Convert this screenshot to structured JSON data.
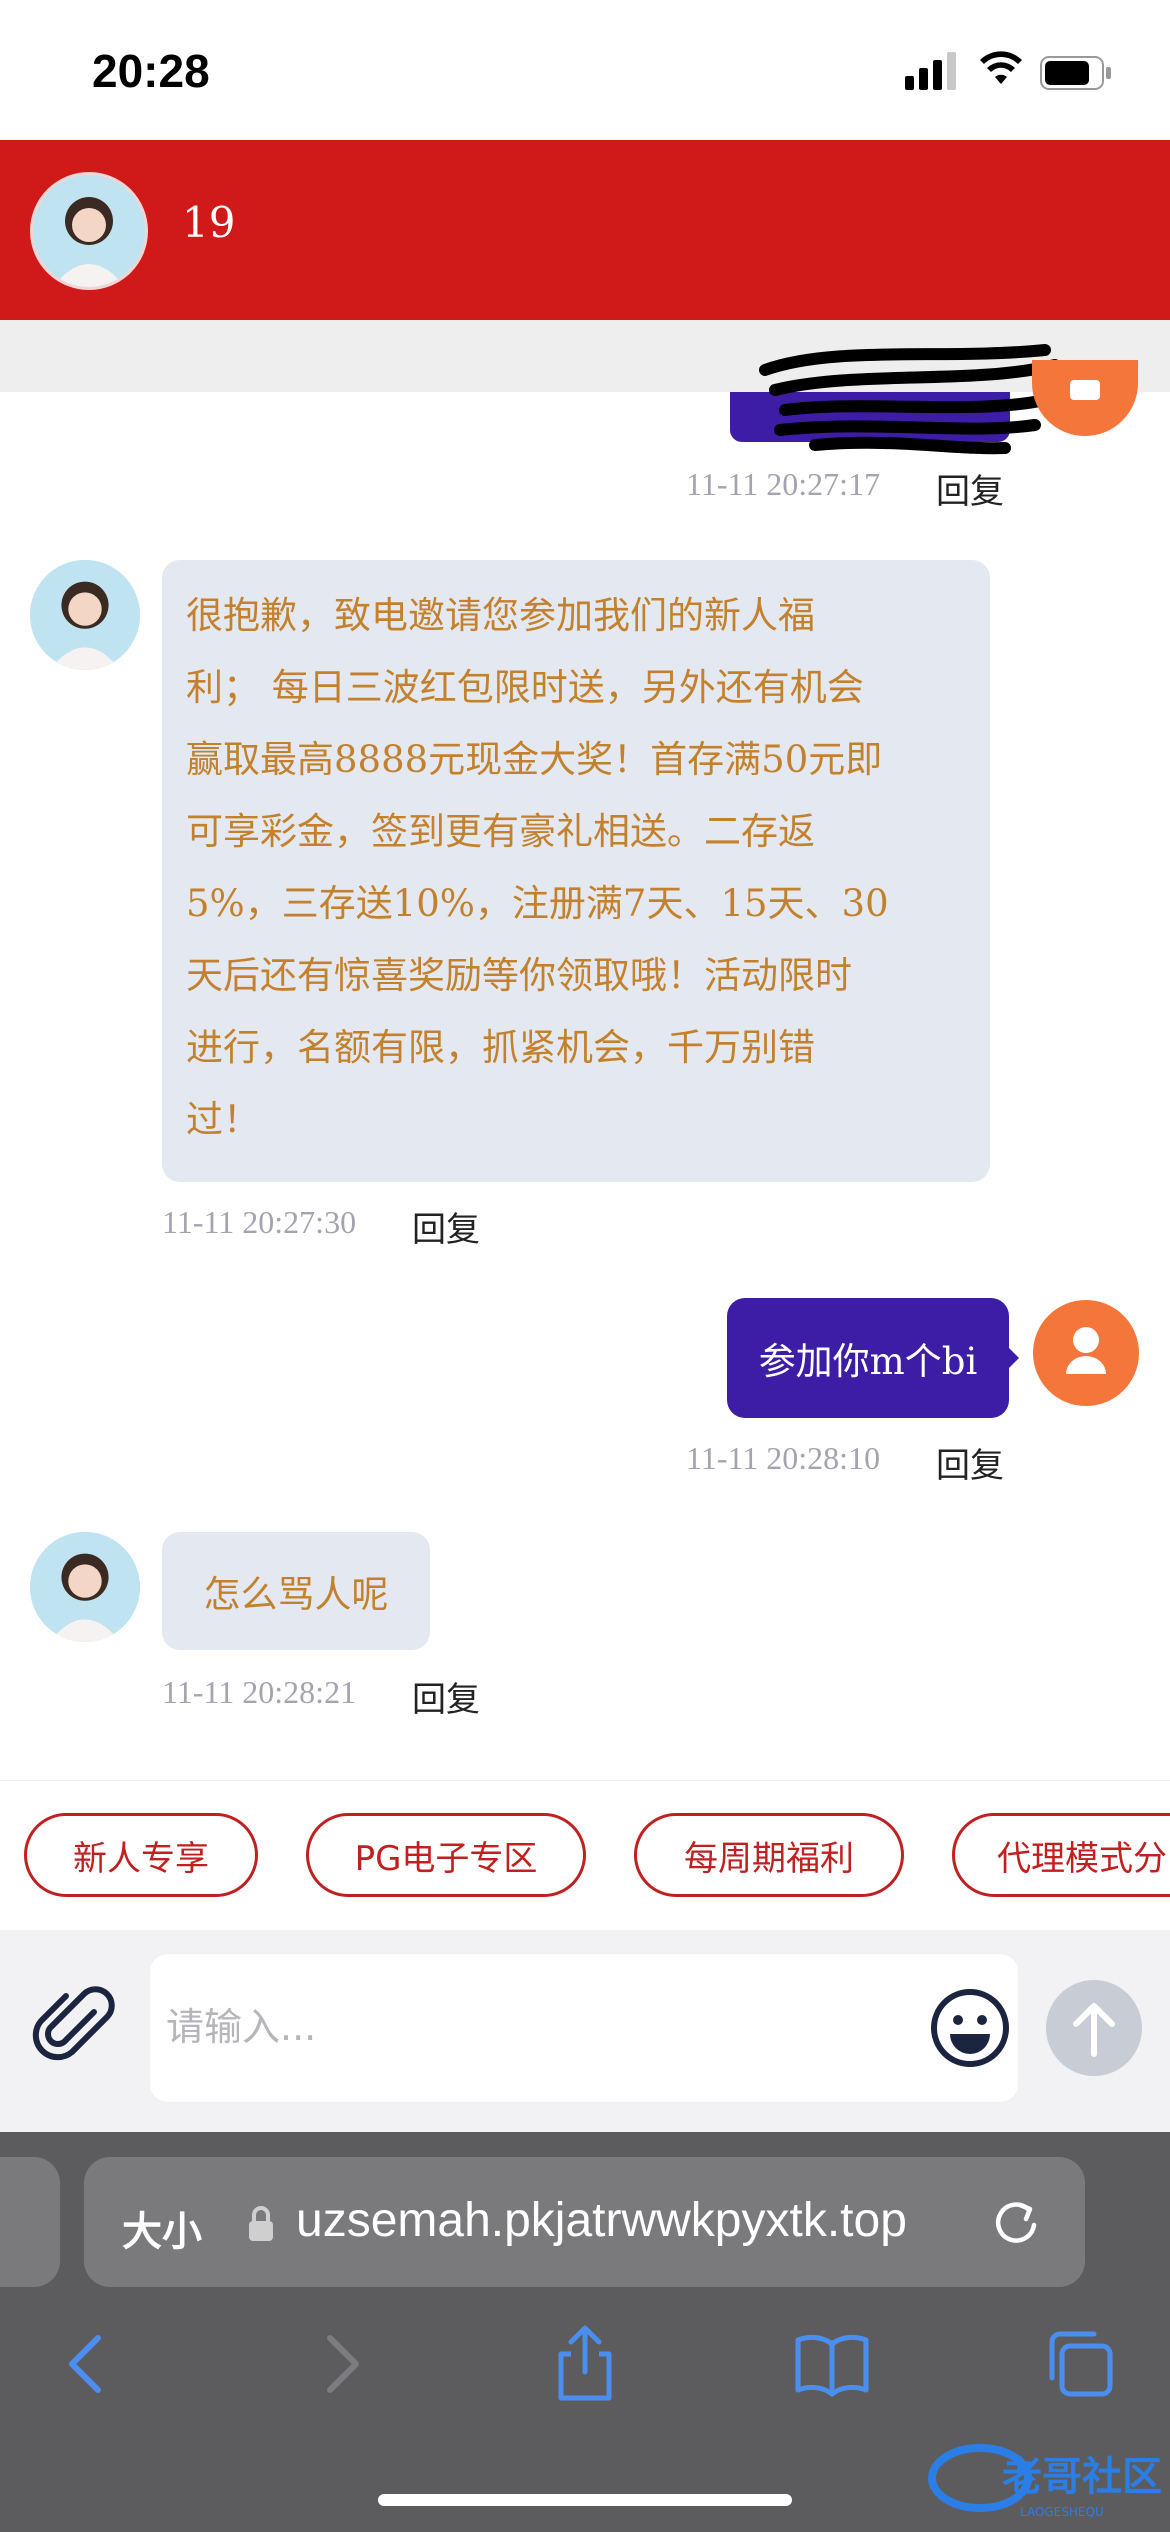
{
  "status_bar": {
    "time": "20:28"
  },
  "header": {
    "title": "19"
  },
  "messages": [
    {
      "side": "right",
      "timestamp": "11-11 20:27:17",
      "reply_label": "回复"
    },
    {
      "side": "left",
      "text": "很抱歉，致电邀请您参加我们的新人福利；每日三波红包限时送，另外还有机会赢取最高8888元现金大奖！首存满50元即可享彩金，签到更有豪礼相送。二存返5%，三存送10%，注册满7天、15天、30天后还有惊喜奖励等你领取哦！活动限时进行，名额有限，抓紧机会，千万别错过！",
      "lines": [
        "很抱歉，致电邀请您参加我们的新人福",
        "利； 每日三波红包限时送，另外还有机会",
        "赢取最高8888元现金大奖！首存满50元即",
        "可享彩金，签到更有豪礼相送。二存返",
        "5%，三存送10%，注册满7天、15天、30",
        "天后还有惊喜奖励等你领取哦！活动限时",
        "进行，名额有限，抓紧机会，千万别错",
        "过！"
      ],
      "timestamp": "11-11 20:27:30",
      "reply_label": "回复"
    },
    {
      "side": "right",
      "text": "参加你m个bi",
      "timestamp": "11-11 20:28:10",
      "reply_label": "回复"
    },
    {
      "side": "left",
      "text": "怎么骂人呢",
      "timestamp": "11-11 20:28:21",
      "reply_label": "回复"
    }
  ],
  "quick_chips": [
    "新人专享",
    "PG电子专区",
    "每周期福利",
    "代理模式分"
  ],
  "input": {
    "placeholder": "请输入..."
  },
  "browser": {
    "text_size_label": "大小",
    "url": "uzsemah.pkjatrwwkpyxtk.top"
  },
  "watermark": {
    "text": "老哥社区",
    "subtext": "LAOGESHEQU"
  },
  "colors": {
    "header": "#d01a1a",
    "incoming_bubble": "#e4e8f0",
    "incoming_text": "#c4812d",
    "outgoing_bubble": "#3d1ca6",
    "user_avatar": "#f4763a"
  }
}
